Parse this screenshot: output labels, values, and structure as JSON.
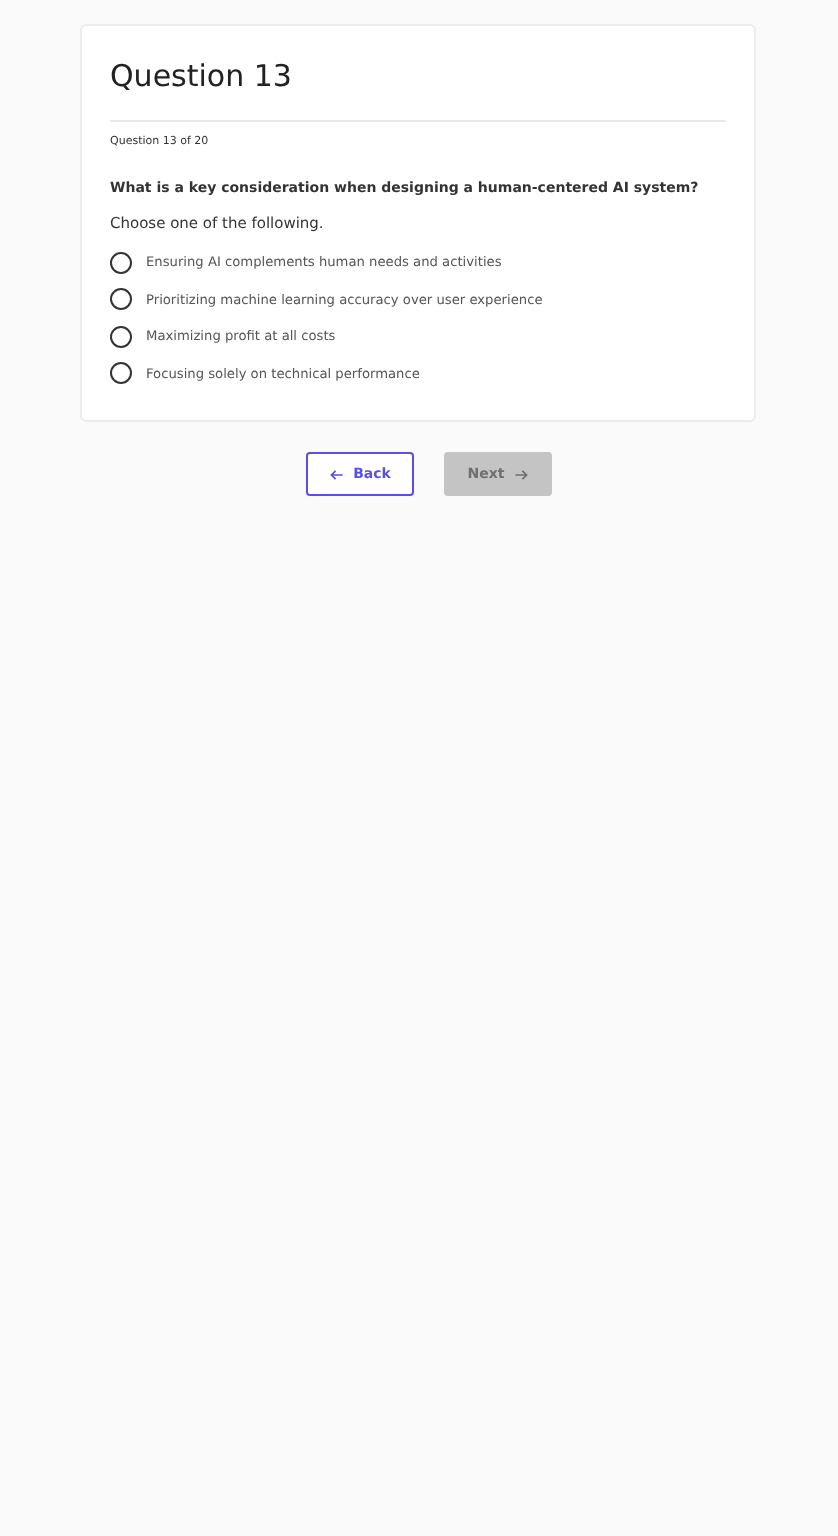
{
  "title": "Question 13",
  "progress": "Question 13 of 20",
  "question": "What is a key consideration when designing a human-centered AI system?",
  "instruction": "Choose one of the following.",
  "options": [
    {
      "label": "Ensuring AI complements human needs and activities",
      "selected": false
    },
    {
      "label": "Prioritizing machine learning accuracy over user experience",
      "selected": false
    },
    {
      "label": "Maximizing profit at all costs",
      "selected": false
    },
    {
      "label": "Focusing solely on technical performance",
      "selected": false
    }
  ],
  "back": {
    "label": "Back",
    "disabled": false
  },
  "next": {
    "label": "Next",
    "disabled": true
  }
}
